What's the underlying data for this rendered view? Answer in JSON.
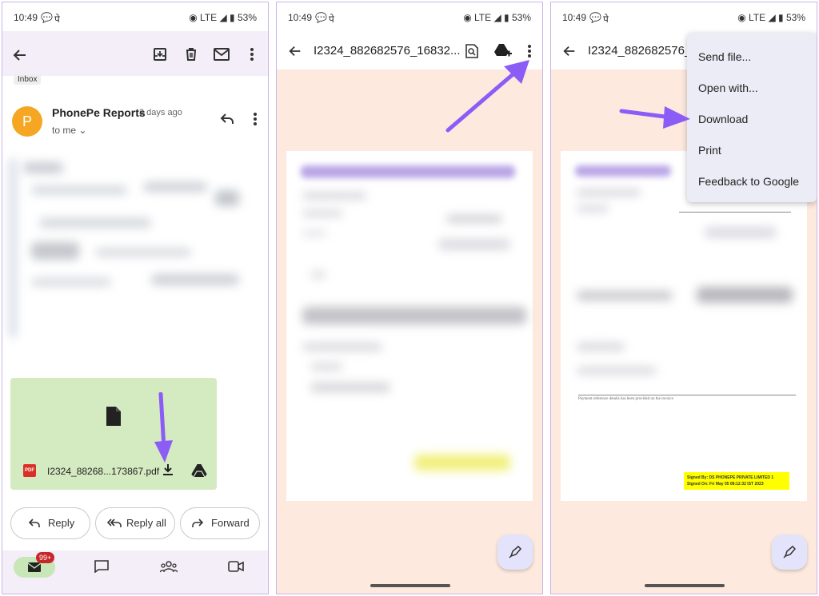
{
  "status": {
    "time": "10:49",
    "bubble": "●",
    "ve": "पे",
    "net": "LTE",
    "battery": "53%"
  },
  "panel1": {
    "inbox_label": "Inbox",
    "avatar_letter": "P",
    "sender": "PhonePe Reports",
    "time_ago": "3 days ago",
    "to": "to me",
    "attachment_name": "I2324_88268...173867.pdf",
    "pdf_badge": "PDF",
    "reply": "Reply",
    "reply_all": "Reply all",
    "forward": "Forward",
    "mail_badge": "99+"
  },
  "panel2": {
    "file_title": "I2324_882682576_16832..."
  },
  "panel3": {
    "file_title": "I2324_882682576_16",
    "menu": [
      "Send file...",
      "Open with...",
      "Download",
      "Print",
      "Feedback to Google"
    ],
    "signed_line1": "Signed By: DS PHONEPE PRIVATE LIMITED 1",
    "signed_line2": "Signed On: Fri May 05 08:12:32 IST 2023",
    "footnote": "Payment reference details has been provided on the invoice"
  },
  "colors": {
    "accent": "#7b4dff",
    "arrow": "#8b5cf6",
    "avatar": "#f5a623",
    "attachment_bg": "#d4eac0",
    "doc_bg": "#fde9de",
    "signed_bg": "#ffff00",
    "badge": "#c62828"
  }
}
